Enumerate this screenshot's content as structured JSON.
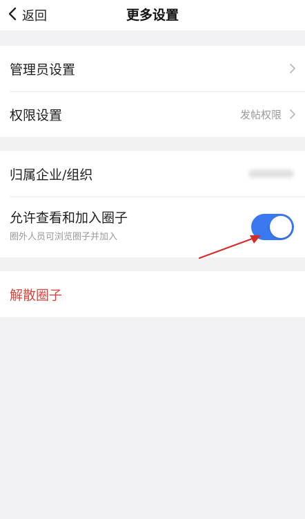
{
  "header": {
    "back_label": "返回",
    "title": "更多设置"
  },
  "settings": {
    "admin": {
      "label": "管理员设置"
    },
    "permission": {
      "label": "权限设置",
      "value": "发帖权限"
    },
    "organization": {
      "label": "归属企业/组织"
    },
    "allow_view_join": {
      "label": "允许查看和加入圈子",
      "subtitle": "圈外人员可浏览圈子并加入",
      "enabled": true
    },
    "dissolve": {
      "label": "解散圈子"
    }
  },
  "colors": {
    "accent": "#3a78f0",
    "danger": "#d8453c",
    "annotation_arrow": "#d42b2b"
  },
  "icons": [
    "chevron-left-icon",
    "chevron-right-icon"
  ]
}
